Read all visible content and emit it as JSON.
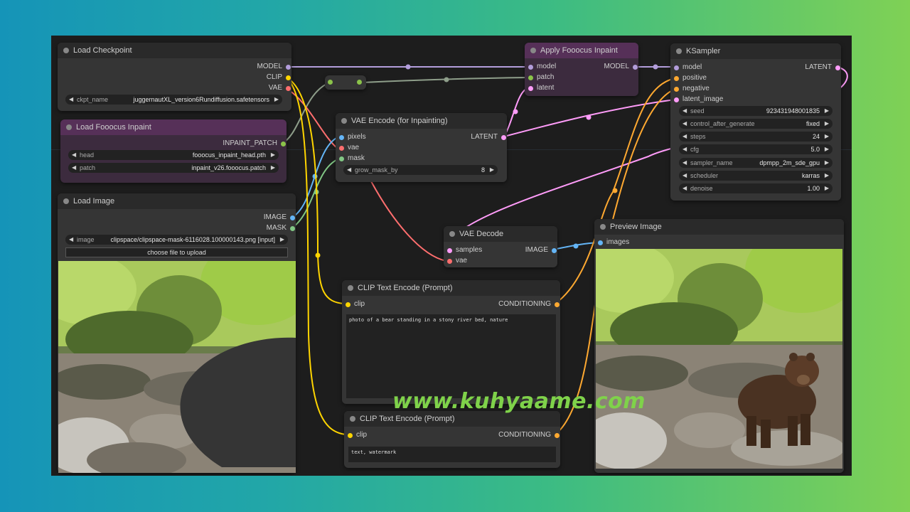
{
  "colors": {
    "model": "#b39ddb",
    "clip": "#ffd500",
    "vae": "#ff6e6e",
    "latent": "#ff9cf9",
    "image": "#64b5f6",
    "mask": "#81c784",
    "conditioning": "#ffa931",
    "inpaint": "#8bc34a"
  },
  "load_checkpoint": {
    "title": "Load Checkpoint",
    "out_model": "MODEL",
    "out_clip": "CLIP",
    "out_vae": "VAE",
    "ckpt_label": "ckpt_name",
    "ckpt_value": "juggernautXL_version6Rundiffusion.safetensors"
  },
  "load_fooocus_inpaint": {
    "title": "Load Fooocus Inpaint",
    "out_patch": "INPAINT_PATCH",
    "head_label": "head",
    "head_value": "fooocus_inpaint_head.pth",
    "patch_label": "patch",
    "patch_value": "inpaint_v26.fooocus.patch"
  },
  "load_image": {
    "title": "Load Image",
    "out_image": "IMAGE",
    "out_mask": "MASK",
    "image_label": "image",
    "image_value": "clipspace/clipspace-mask-6116028.100000143.png [input]",
    "upload_label": "choose file to upload"
  },
  "vae_encode": {
    "title": "VAE Encode (for Inpainting)",
    "in_pixels": "pixels",
    "in_vae": "vae",
    "in_mask": "mask",
    "out_latent": "LATENT",
    "grow_label": "grow_mask_by",
    "grow_value": "8"
  },
  "apply_fooocus": {
    "title": "Apply Fooocus Inpaint",
    "in_model": "model",
    "in_patch": "patch",
    "in_latent": "latent",
    "out_model": "MODEL"
  },
  "ksampler": {
    "title": "KSampler",
    "in_model": "model",
    "in_positive": "positive",
    "in_negative": "negative",
    "in_latent": "latent_image",
    "out_latent": "LATENT",
    "widgets": [
      {
        "label": "seed",
        "value": "923431948001835"
      },
      {
        "label": "control_after_generate",
        "value": "fixed"
      },
      {
        "label": "steps",
        "value": "24"
      },
      {
        "label": "cfg",
        "value": "5.0"
      },
      {
        "label": "sampler_name",
        "value": "dpmpp_2m_sde_gpu"
      },
      {
        "label": "scheduler",
        "value": "karras"
      },
      {
        "label": "denoise",
        "value": "1.00"
      }
    ]
  },
  "vae_decode": {
    "title": "VAE Decode",
    "in_samples": "samples",
    "in_vae": "vae",
    "out_image": "IMAGE"
  },
  "clip_pos": {
    "title": "CLIP Text Encode (Prompt)",
    "in_clip": "clip",
    "out_cond": "CONDITIONING",
    "text": "photo of a bear standing in a stony river bed, nature"
  },
  "clip_neg": {
    "title": "CLIP Text Encode (Prompt)",
    "in_clip": "clip",
    "out_cond": "CONDITIONING",
    "text": "text, watermark"
  },
  "preview": {
    "title": "Preview Image",
    "in_images": "images"
  },
  "watermark": "www.kuhyaame.com"
}
